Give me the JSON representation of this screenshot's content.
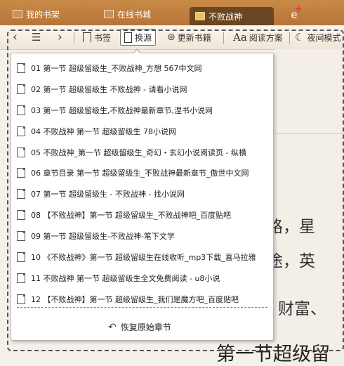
{
  "tabs": [
    {
      "label": "我的书架"
    },
    {
      "label": "在线书城"
    },
    {
      "label": "不败战神"
    }
  ],
  "toolbar": {
    "back_icon": "chevron-left-icon",
    "list_icon": "list-icon",
    "forward_icon": "chevron-right-icon",
    "bookmark_label": "书签",
    "source_label": "换源",
    "update_label": "更新书籍",
    "reading_label": "阅读方案",
    "night_label": "夜间模式"
  },
  "sources": [
    {
      "label": "01 第一节 超级留级生_不败战神_方想 567中文网"
    },
    {
      "label": "02 第一节 超级留级生 不败战神 - 请看小说网"
    },
    {
      "label": "03 第一节 超级留级生,不败战神最新章节,涅书小说网"
    },
    {
      "label": "04 不败战神 第一节 超级留级生 78小说网"
    },
    {
      "label": "05 不败战神_第一节 超级留级生_奇幻・玄幻小说阅读页 - 纵横"
    },
    {
      "label": "06 章节目录 第一节 超级留级生_不败战神最新章节_傲世中文网"
    },
    {
      "label": "07 第一节 超级留级生 - 不败战神 - 找小说网"
    },
    {
      "label": "08 【不败战神】第一节 超级留级生_不败战神吧_百度贴吧"
    },
    {
      "label": "09 第一节 超级留级生-不败战神-笔下文学"
    },
    {
      "label": "10 《不败战神》第一节 超级留级生在线收听_mp3下载_喜马拉雅"
    },
    {
      "label": "11 不败战神 第一节 超级留级生全文免费阅读 - u8小说"
    },
    {
      "label": "12 【不败战神】第一节 超级留级生_我们是魔方吧_百度贴吧"
    }
  ],
  "restore_label": "恢复原始章节",
  "page_text": {
    "line1": "路，星",
    "line2": "途，英",
    "line3": "财富、",
    "heading": "第一节超级留"
  }
}
